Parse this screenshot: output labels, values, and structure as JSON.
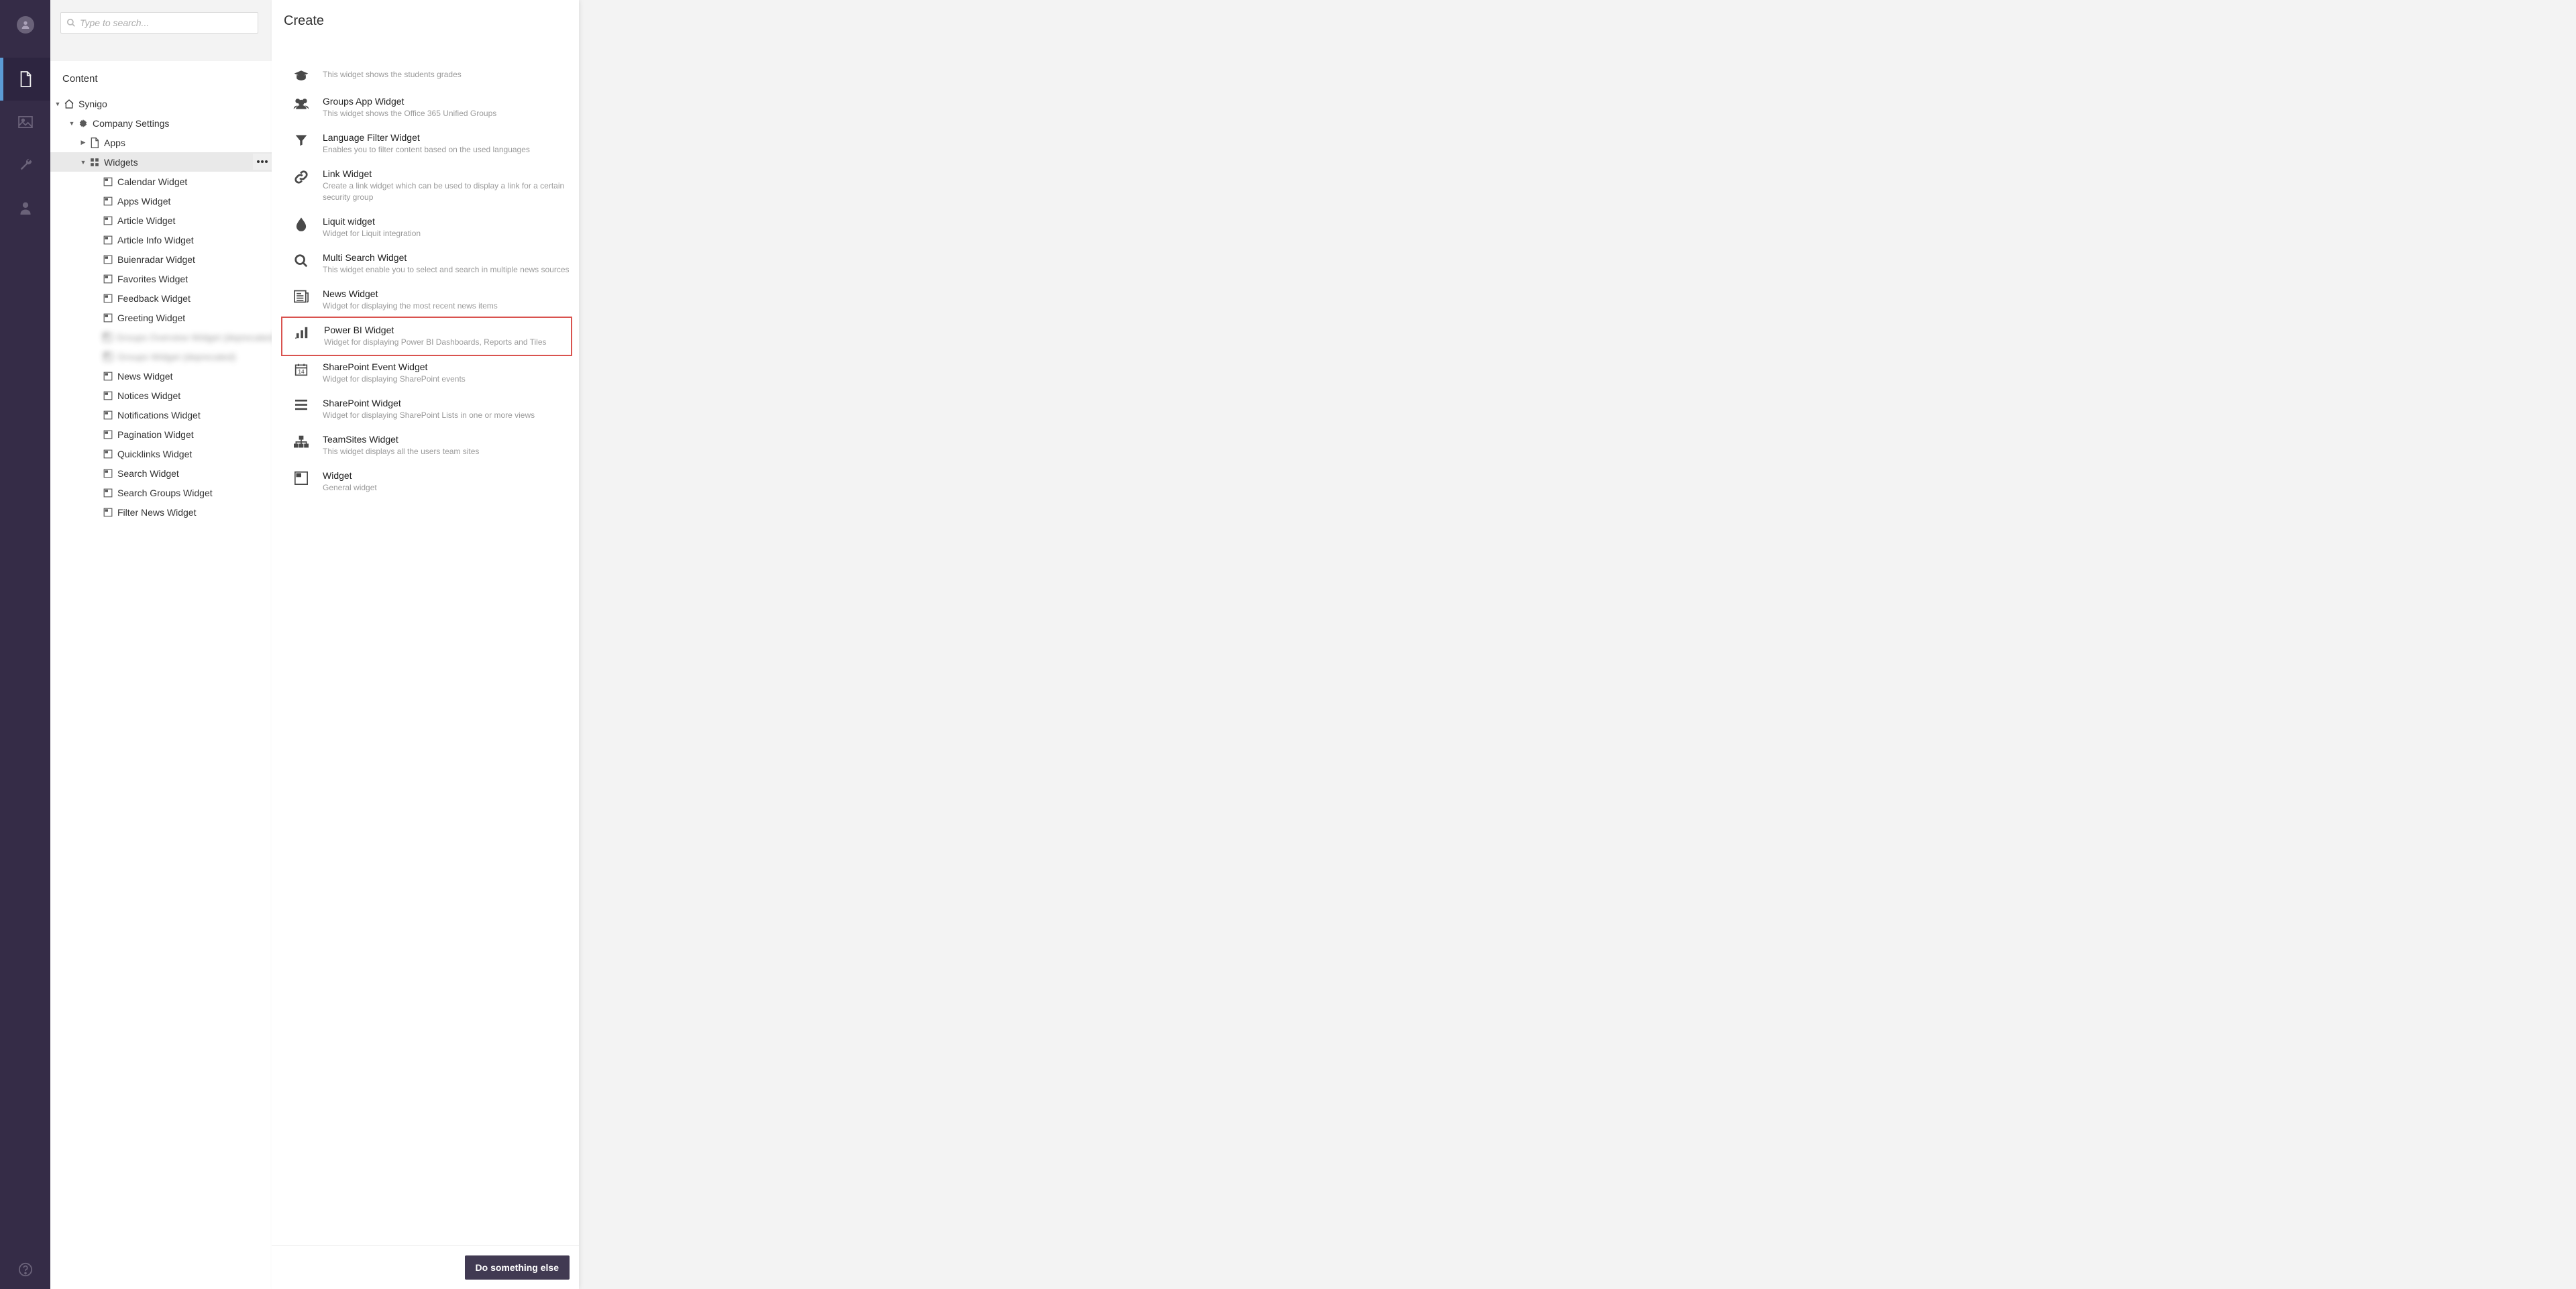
{
  "search": {
    "placeholder": "Type to search..."
  },
  "sidebar": {
    "title": "Content",
    "root": "Synigo",
    "company": "Company Settings",
    "apps": "Apps",
    "widgets": "Widgets",
    "widget_items": [
      "Calendar Widget",
      "Apps Widget",
      "Article Widget",
      "Article Info Widget",
      "Buienradar Widget",
      "Favorites Widget",
      "Feedback Widget",
      "Greeting Widget"
    ],
    "widget_blurred": [
      "Groups Overview Widget (deprecated)",
      "Groups Widget (deprecated)"
    ],
    "widget_items2": [
      "News Widget",
      "Notices Widget",
      "Notifications Widget",
      "Pagination Widget",
      "Quicklinks Widget",
      "Search Widget",
      "Search Groups Widget",
      "Filter News Widget"
    ]
  },
  "create": {
    "title": "Create",
    "partial_desc": "This widget shows the students grades",
    "items": [
      {
        "icon": "group",
        "title": "Groups App Widget",
        "desc": "This widget shows the Office 365 Unified Groups"
      },
      {
        "icon": "filter",
        "title": "Language Filter Widget",
        "desc": "Enables you to filter content based on the used languages"
      },
      {
        "icon": "link",
        "title": "Link Widget",
        "desc": "Create a link widget which can be used to display a link for a certain security group"
      },
      {
        "icon": "drop",
        "title": "Liquit widget",
        "desc": "Widget for Liquit integration"
      },
      {
        "icon": "search",
        "title": "Multi Search Widget",
        "desc": "This widget enable you to select and search in multiple news sources"
      },
      {
        "icon": "news",
        "title": "News Widget",
        "desc": "Widget for displaying the most recent news items"
      },
      {
        "icon": "chart",
        "title": "Power BI Widget",
        "desc": "Widget for displaying Power BI Dashboards, Reports and Tiles",
        "highlight": true
      },
      {
        "icon": "calendar",
        "title": "SharePoint Event Widget",
        "desc": "Widget for displaying SharePoint events"
      },
      {
        "icon": "list",
        "title": "SharePoint Widget",
        "desc": "Widget for displaying SharePoint Lists in one or more views"
      },
      {
        "icon": "sitemap",
        "title": "TeamSites Widget",
        "desc": "This widget displays all the users team sites"
      },
      {
        "icon": "widget",
        "title": "Widget",
        "desc": "General widget"
      }
    ],
    "footer_button": "Do something else"
  }
}
